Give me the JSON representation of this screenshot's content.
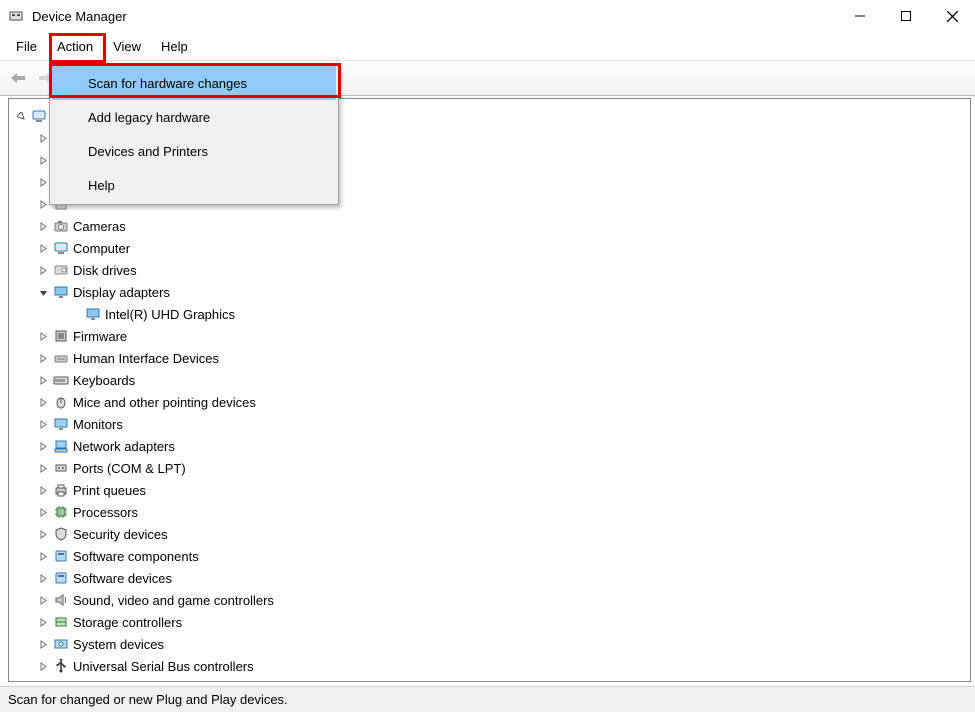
{
  "window": {
    "title": "Device Manager"
  },
  "menubar": {
    "items": [
      "File",
      "Action",
      "View",
      "Help"
    ],
    "activeIndex": 1
  },
  "dropdown": {
    "items": [
      "Scan for hardware changes",
      "Add legacy hardware",
      "Devices and Printers",
      "Help"
    ],
    "highlightedIndex": 0
  },
  "tree": {
    "root": {
      "label": ""
    },
    "nodes": [
      {
        "level": 1,
        "label": "",
        "icon": "generic",
        "expand": "closed"
      },
      {
        "level": 1,
        "label": "",
        "icon": "generic",
        "expand": "closed"
      },
      {
        "level": 1,
        "label": "",
        "icon": "generic",
        "expand": "closed"
      },
      {
        "level": 1,
        "label": "",
        "icon": "generic",
        "expand": "closed"
      },
      {
        "level": 1,
        "label": "Cameras",
        "icon": "camera",
        "expand": "closed"
      },
      {
        "level": 1,
        "label": "Computer",
        "icon": "computer",
        "expand": "closed"
      },
      {
        "level": 1,
        "label": "Disk drives",
        "icon": "disk",
        "expand": "closed"
      },
      {
        "level": 1,
        "label": "Display adapters",
        "icon": "display",
        "expand": "open"
      },
      {
        "level": 2,
        "label": "Intel(R) UHD Graphics",
        "icon": "display",
        "expand": "none"
      },
      {
        "level": 1,
        "label": "Firmware",
        "icon": "firmware",
        "expand": "closed"
      },
      {
        "level": 1,
        "label": "Human Interface Devices",
        "icon": "hid",
        "expand": "closed"
      },
      {
        "level": 1,
        "label": "Keyboards",
        "icon": "keyboard",
        "expand": "closed"
      },
      {
        "level": 1,
        "label": "Mice and other pointing devices",
        "icon": "mouse",
        "expand": "closed"
      },
      {
        "level": 1,
        "label": "Monitors",
        "icon": "monitor",
        "expand": "closed"
      },
      {
        "level": 1,
        "label": "Network adapters",
        "icon": "network",
        "expand": "closed"
      },
      {
        "level": 1,
        "label": "Ports (COM & LPT)",
        "icon": "port",
        "expand": "closed"
      },
      {
        "level": 1,
        "label": "Print queues",
        "icon": "printer",
        "expand": "closed"
      },
      {
        "level": 1,
        "label": "Processors",
        "icon": "cpu",
        "expand": "closed"
      },
      {
        "level": 1,
        "label": "Security devices",
        "icon": "security",
        "expand": "closed"
      },
      {
        "level": 1,
        "label": "Software components",
        "icon": "software",
        "expand": "closed"
      },
      {
        "level": 1,
        "label": "Software devices",
        "icon": "software",
        "expand": "closed"
      },
      {
        "level": 1,
        "label": "Sound, video and game controllers",
        "icon": "sound",
        "expand": "closed"
      },
      {
        "level": 1,
        "label": "Storage controllers",
        "icon": "storage",
        "expand": "closed"
      },
      {
        "level": 1,
        "label": "System devices",
        "icon": "system",
        "expand": "closed"
      },
      {
        "level": 1,
        "label": "Universal Serial Bus controllers",
        "icon": "usb",
        "expand": "closed"
      }
    ]
  },
  "statusbar": {
    "text": "Scan for changed or new Plug and Play devices."
  },
  "icons": {
    "camera": "#7b7b7b",
    "computer": "#2a7ab0",
    "disk": "#8a8a8a",
    "display": "#2a7ab0",
    "firmware": "#555",
    "hid": "#777",
    "keyboard": "#555",
    "mouse": "#555",
    "monitor": "#2a7ab0",
    "network": "#2a7ab0",
    "port": "#555",
    "printer": "#555",
    "cpu": "#3a7a3a",
    "security": "#555",
    "software": "#3a7ab0",
    "sound": "#666",
    "storage": "#3a7a3a",
    "system": "#2a7ab0",
    "usb": "#333",
    "generic": "#888"
  }
}
